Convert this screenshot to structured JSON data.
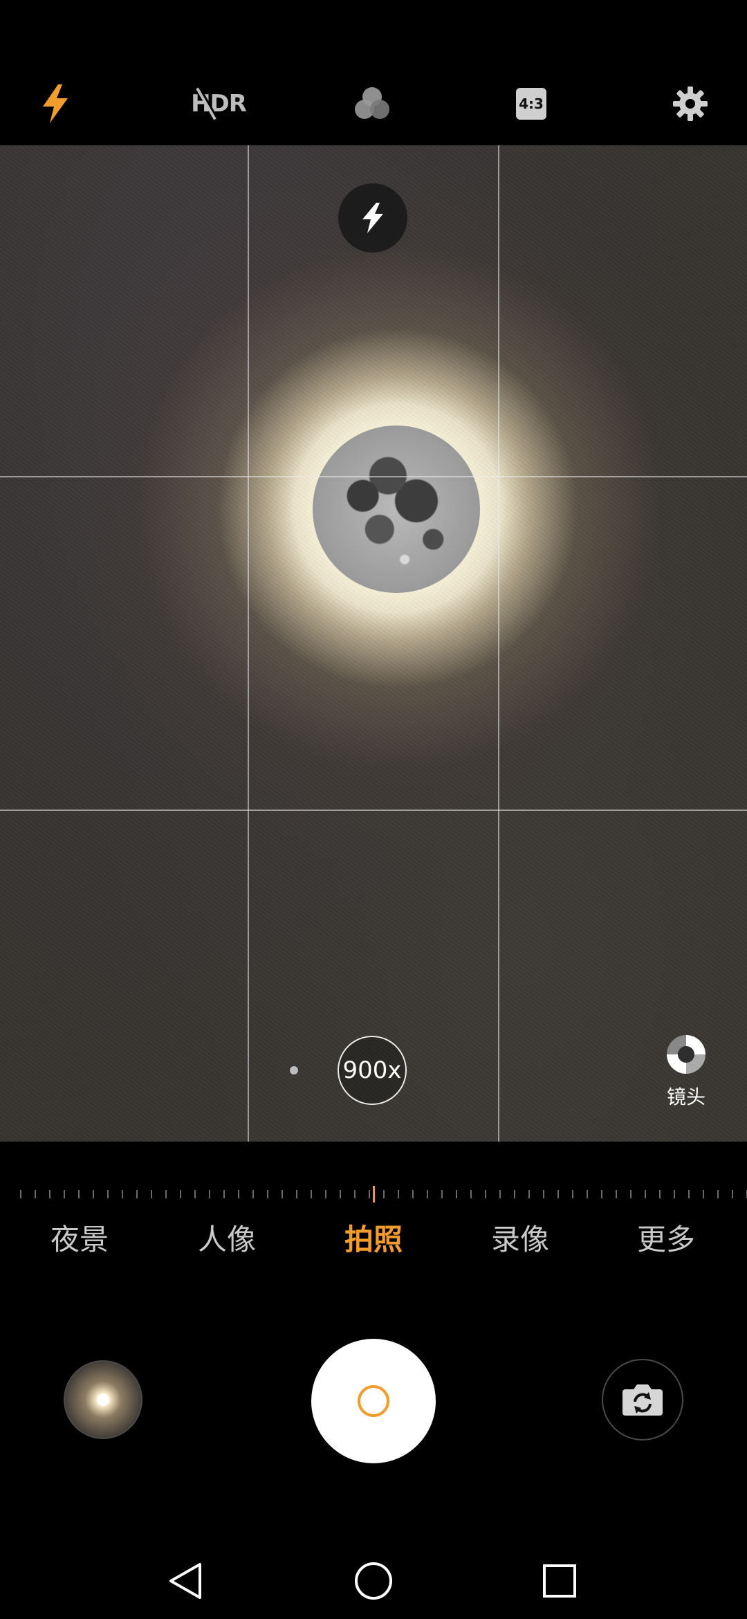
{
  "toolbar": {
    "flash_icon": "flash-on-icon",
    "hdr_label": "HDR",
    "hdr_state": "off",
    "filters_icon": "filter-circles-icon",
    "aspect_ratio": "4:3",
    "settings_icon": "gear-icon"
  },
  "viewfinder": {
    "flash_chip_icon": "flash-icon",
    "zoom": "900x",
    "lens_label": "镜头"
  },
  "modes": {
    "items": [
      "夜景",
      "人像",
      "拍照",
      "录像",
      "更多"
    ],
    "active": "拍照"
  },
  "bottom": {
    "thumbnail": "last-photo-thumbnail",
    "shutter": "shutter-button",
    "flip": "switch-camera-icon"
  },
  "colors": {
    "accent": "#f29c2b",
    "background": "#000000"
  }
}
